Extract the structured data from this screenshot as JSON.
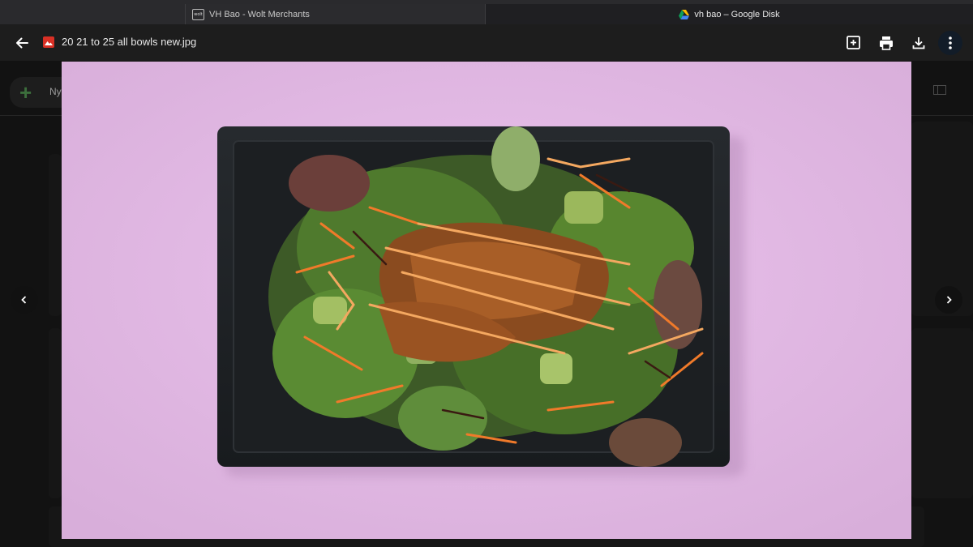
{
  "browser": {
    "tabs": [
      {
        "label": "VH Bao - Wolt Merchants",
        "icon": "wolt-favicon",
        "favicon_text": "wolt"
      },
      {
        "label": "vh bao – Google Disk",
        "icon": "google-drive-favicon",
        "active": true
      }
    ]
  },
  "viewer": {
    "file_name": "20 21 to 25 all bowls new.jpg",
    "file_type_icon": "image-file-icon",
    "toolbar": [
      "add-to-drive-icon",
      "print-icon",
      "download-icon",
      "more-options-icon"
    ],
    "nav": [
      "previous-icon",
      "next-icon"
    ]
  },
  "background_ui": {
    "new_button_label": "Ny"
  },
  "colors": {
    "photo_background": "#e3b8e5",
    "plate": "#1f2225",
    "file_icon": "#d93025"
  }
}
